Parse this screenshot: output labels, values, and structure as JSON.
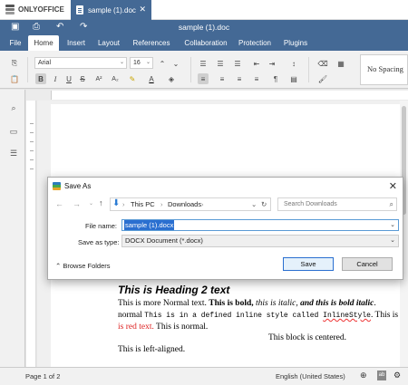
{
  "app": {
    "brand": "ONLYOFFICE",
    "tab_title": "sample (1).doc",
    "doc_title": "sample (1).doc"
  },
  "menu": {
    "tabs": [
      {
        "label": "File"
      },
      {
        "label": "Home",
        "active": true
      },
      {
        "label": "Insert"
      },
      {
        "label": "Layout"
      },
      {
        "label": "References"
      },
      {
        "label": "Collaboration"
      },
      {
        "label": "Protection"
      },
      {
        "label": "Plugins"
      }
    ]
  },
  "toolbar": {
    "font_name": "Arial",
    "font_size": "16",
    "style_preview": "No Spacing",
    "bold": "B",
    "italic": "I",
    "underline": "U",
    "strike": "S",
    "superscript": "A²",
    "subscript": "A₂"
  },
  "document": {
    "heading": "This is Heading 2 text",
    "line1_normal": "This is more Normal text. ",
    "line1_bold": "This is bold, ",
    "line1_italic": "this is italic, ",
    "line1_bolditalic": "and this is bold italic",
    "line1_end": ".",
    "line2_normal": "normal ",
    "line2_mono_a": "This is in a defined inline style called ",
    "line2_mono_b": "InlineStyle",
    "line2_end": ". This is",
    "line3_red": "is red text.",
    "line3_normal": " This is normal.",
    "centered": "This block is centered.",
    "left_aligned": "This is left-aligned."
  },
  "dialog": {
    "title": "Save As",
    "path": [
      "This PC",
      "Downloads"
    ],
    "search_placeholder": "Search Downloads",
    "file_name_label": "File name:",
    "file_name_value": "sample (1).docx",
    "save_type_label": "Save as type:",
    "save_type_value": "DOCX Document (*.docx)",
    "browse_folders": "Browse Folders",
    "save_button": "Save",
    "cancel_button": "Cancel"
  },
  "status": {
    "page_info": "Page 1 of 2",
    "language": "English (United States)"
  },
  "colors": {
    "header_blue": "#446995",
    "red_text": "#dd2222",
    "selection_blue": "#2a6fd0"
  }
}
